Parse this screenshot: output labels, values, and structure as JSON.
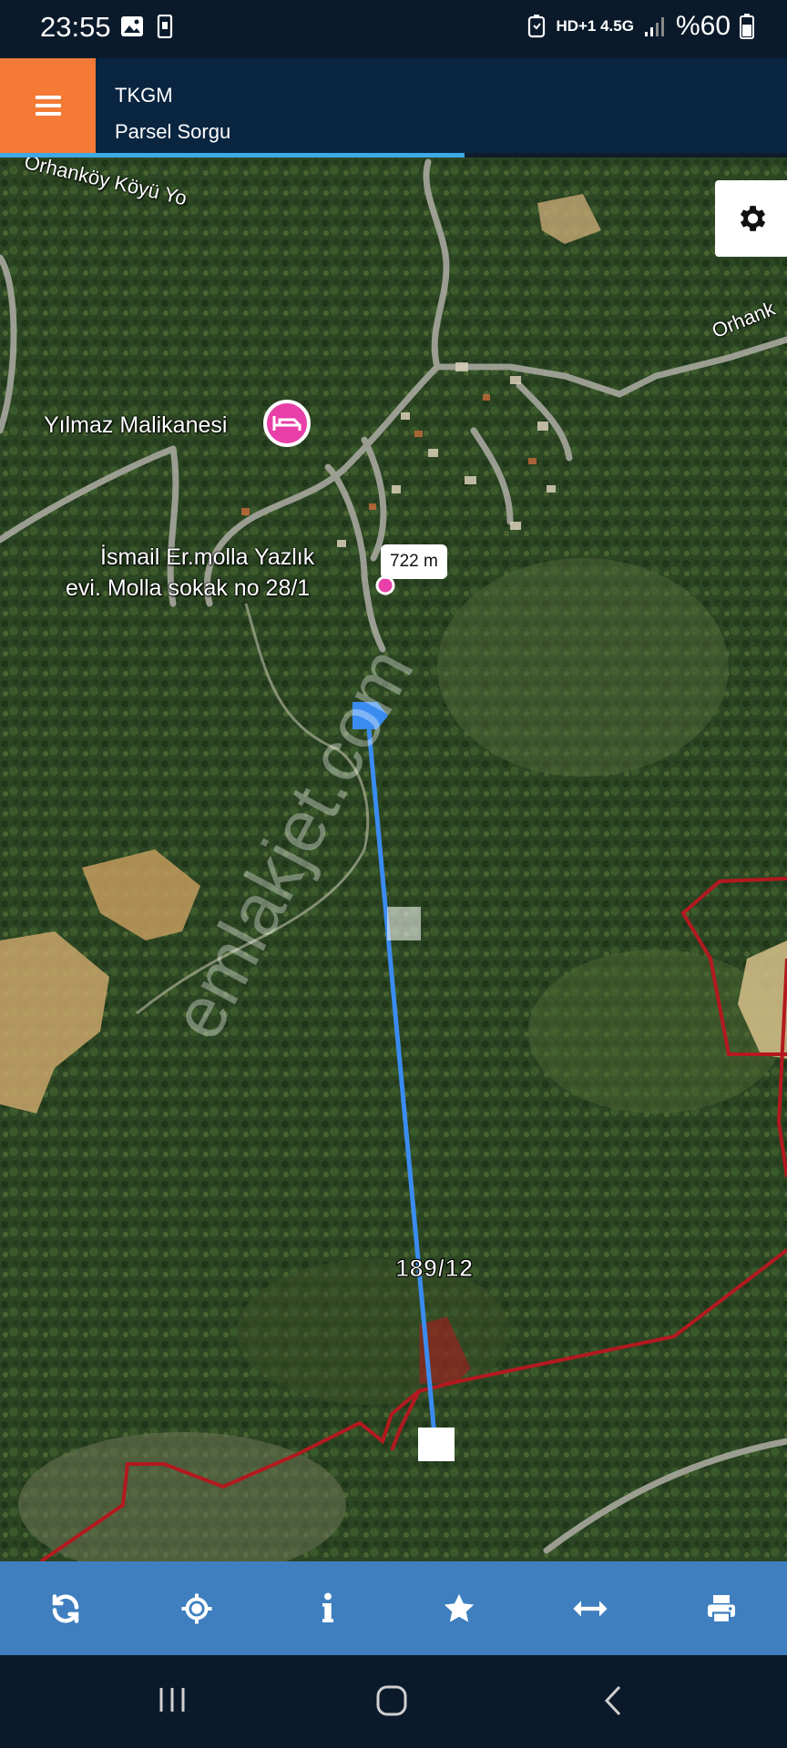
{
  "status": {
    "time": "23:55",
    "network": "HD+1 4.5G",
    "battery": "%60"
  },
  "header": {
    "title": "TKGM",
    "subtitle": "Parsel Sorgu"
  },
  "map": {
    "distance_label": "722 m",
    "parcel_label": "189/12",
    "place_labels": {
      "hotel": "Yılmaz Malikanesi",
      "poi_line1": "İsmail Er.molla Yazlık",
      "poi_line2": "evi. Molla sokak no 28/1",
      "road_top_left": "Orhanköy Köyü Yo",
      "road_top_right": "Orhank"
    },
    "watermark": "emlakjet.com",
    "colors": {
      "measure_line": "#3b8cf0",
      "parcel_boundary": "#b3191f",
      "hotel_pin": "#e83fa8"
    }
  },
  "toolbar": {
    "buttons": [
      "refresh-icon",
      "crosshair-icon",
      "info-icon",
      "star-icon",
      "measure-icon",
      "print-icon"
    ]
  },
  "nav": {
    "buttons": [
      "recent-apps-icon",
      "home-icon",
      "back-icon"
    ]
  }
}
